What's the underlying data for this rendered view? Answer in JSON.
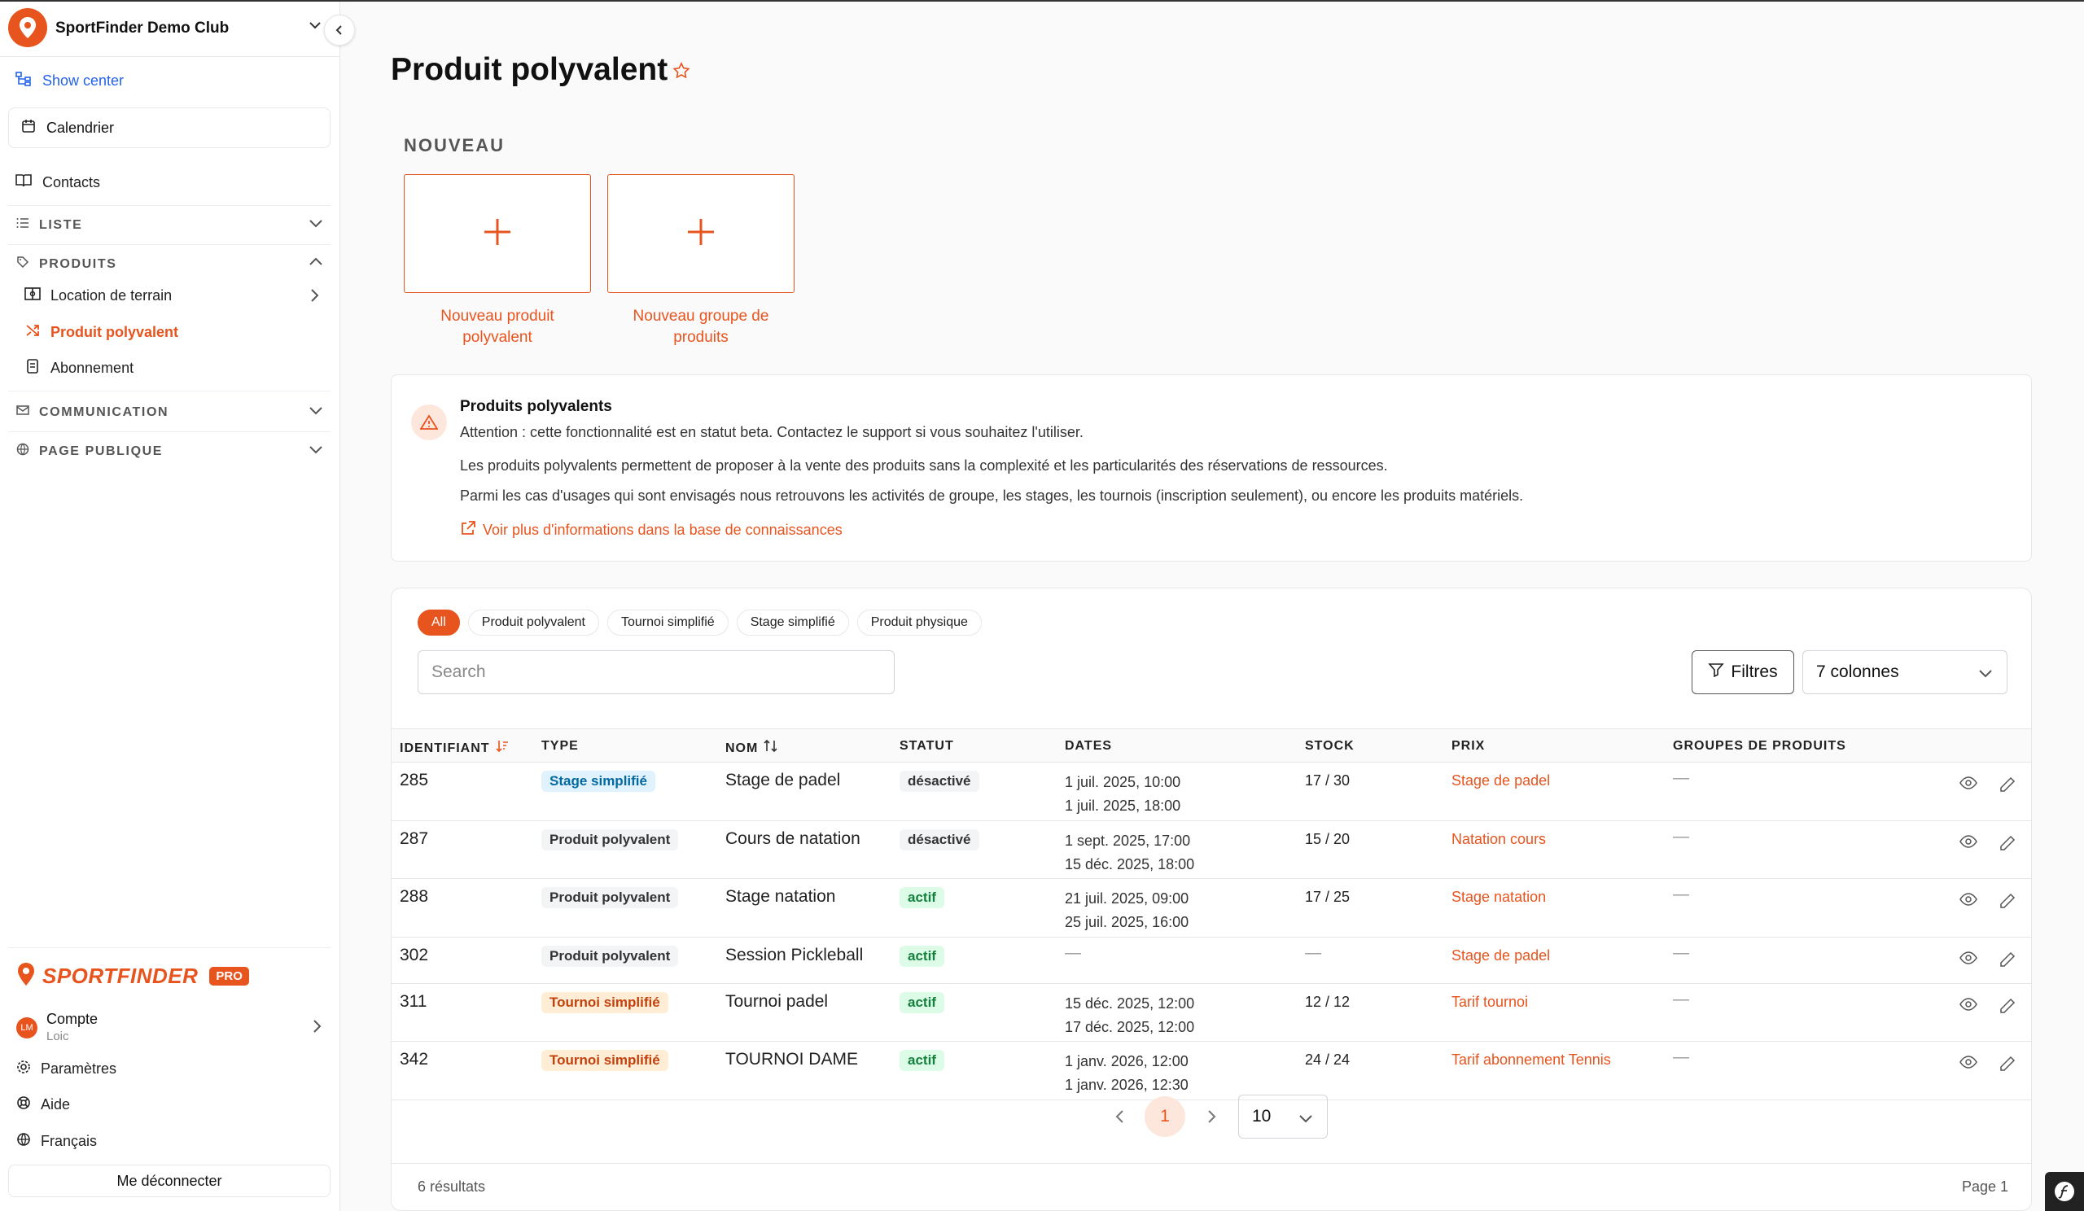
{
  "club": {
    "name": "SportFinder Demo Club"
  },
  "sidebar": {
    "show_center": "Show center",
    "calendrier": "Calendrier",
    "contacts": "Contacts",
    "liste": "LISTE",
    "produits": "PRODUITS",
    "produits_items": [
      "Location de terrain",
      "Produit polyvalent",
      "Abonnement"
    ],
    "communication": "COMMUNICATION",
    "page_publique": "PAGE PUBLIQUE",
    "brand": "SPORTFINDER",
    "pro": "PRO",
    "account_label": "Compte",
    "account_user": "Loic",
    "avatar_initials": "LM",
    "parametres": "Paramètres",
    "aide": "Aide",
    "langue": "Français",
    "logout": "Me déconnecter"
  },
  "page": {
    "title": "Produit polyvalent"
  },
  "nouveau": {
    "heading": "NOUVEAU",
    "card1": "Nouveau produit polyvalent",
    "card2": "Nouveau groupe de produits"
  },
  "info": {
    "title": "Produits polyvalents",
    "line1": "Attention : cette fonctionnalité est en statut beta. Contactez le support si vous souhaitez l'utiliser.",
    "line2": "Les produits polyvalents permettent de proposer à la vente des produits sans la complexité et les particularités des réservations de ressources.",
    "line3": "Parmi les cas d'usages qui sont envisagés nous retrouvons les activités de groupe, les stages, les tournois (inscription seulement), ou encore les produits matériels.",
    "link": "Voir plus d'informations dans la base de connaissances"
  },
  "filters": {
    "chips": [
      "All",
      "Produit polyvalent",
      "Tournoi simplifié",
      "Stage simplifié",
      "Produit physique"
    ],
    "search_placeholder": "Search",
    "filtres": "Filtres",
    "columns": "7 colonnes"
  },
  "table": {
    "headers": [
      "IDENTIFIANT",
      "TYPE",
      "NOM",
      "STATUT",
      "DATES",
      "STOCK",
      "PRIX",
      "GROUPES DE PRODUITS"
    ],
    "rows": [
      {
        "id": "285",
        "type": "Stage simplifié",
        "nom": "Stage de padel",
        "statut": "désactivé",
        "date1": "1 juil. 2025, 10:00",
        "date2": "1 juil. 2025, 18:00",
        "stock": "17 / 30",
        "prix": "Stage de padel",
        "groupes": "—"
      },
      {
        "id": "287",
        "type": "Produit polyvalent",
        "nom": "Cours de natation",
        "statut": "désactivé",
        "date1": "1 sept. 2025, 17:00",
        "date2": "15 déc. 2025, 18:00",
        "stock": "15 / 20",
        "prix": "Natation cours",
        "groupes": "—"
      },
      {
        "id": "288",
        "type": "Produit polyvalent",
        "nom": "Stage natation",
        "statut": "actif",
        "date1": "21 juil. 2025, 09:00",
        "date2": "25 juil. 2025, 16:00",
        "stock": "17 / 25",
        "prix": "Stage natation",
        "groupes": "—"
      },
      {
        "id": "302",
        "type": "Produit polyvalent",
        "nom": "Session Pickleball",
        "statut": "actif",
        "date1": "—",
        "date2": "",
        "stock": "—",
        "prix": "Stage de padel",
        "groupes": "—"
      },
      {
        "id": "311",
        "type": "Tournoi simplifié",
        "nom": "Tournoi padel",
        "statut": "actif",
        "date1": "15 déc. 2025, 12:00",
        "date2": "17 déc. 2025, 12:00",
        "stock": "12 / 12",
        "prix": "Tarif tournoi",
        "groupes": "—"
      },
      {
        "id": "342",
        "type": "Tournoi simplifié",
        "nom": "TOURNOI DAME",
        "statut": "actif",
        "date1": "1 janv. 2026, 12:00",
        "date2": "1 janv. 2026, 12:30",
        "stock": "24 / 24",
        "prix": "Tarif abonnement Tennis",
        "groupes": "—"
      }
    ]
  },
  "pagination": {
    "current": "1",
    "per_page": "10",
    "results": "6 résultats",
    "page_label": "Page 1"
  },
  "colors": {
    "accent": "#e8541e"
  }
}
